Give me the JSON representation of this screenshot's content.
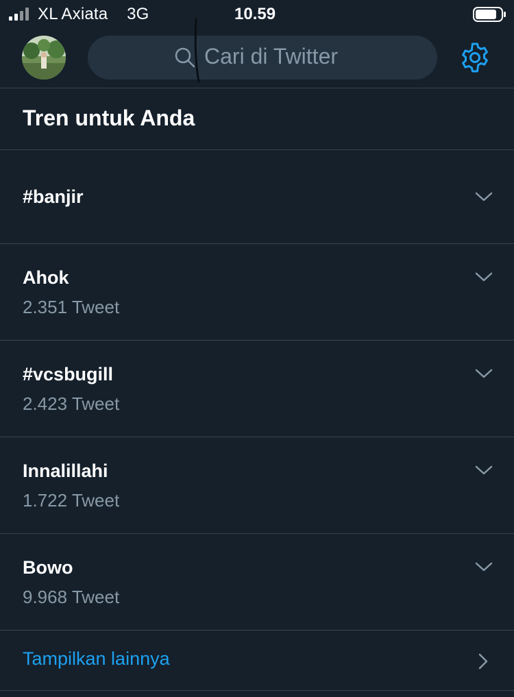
{
  "status_bar": {
    "carrier": "XL Axiata",
    "network": "3G",
    "time": "10.59"
  },
  "search": {
    "placeholder": "Cari di Twitter"
  },
  "section": {
    "title": "Tren untuk Anda"
  },
  "trends": [
    {
      "name": "#banjir",
      "count": ""
    },
    {
      "name": "Ahok",
      "count": "2.351 Tweet"
    },
    {
      "name": "#vcsbugill",
      "count": "2.423 Tweet"
    },
    {
      "name": "Innalillahi",
      "count": "1.722 Tweet"
    },
    {
      "name": "Bowo",
      "count": "9.968 Tweet"
    }
  ],
  "show_more": {
    "label": "Tampilkan lainnya"
  },
  "colors": {
    "background": "#15202b",
    "accent": "#1da1f2",
    "muted_text": "#8899a6",
    "divider": "#38444d",
    "search_bg": "#253341"
  },
  "icons": [
    "signal-icon",
    "battery-icon",
    "avatar",
    "search-icon",
    "gear-icon",
    "chevron-down-icon",
    "chevron-right-icon"
  ]
}
